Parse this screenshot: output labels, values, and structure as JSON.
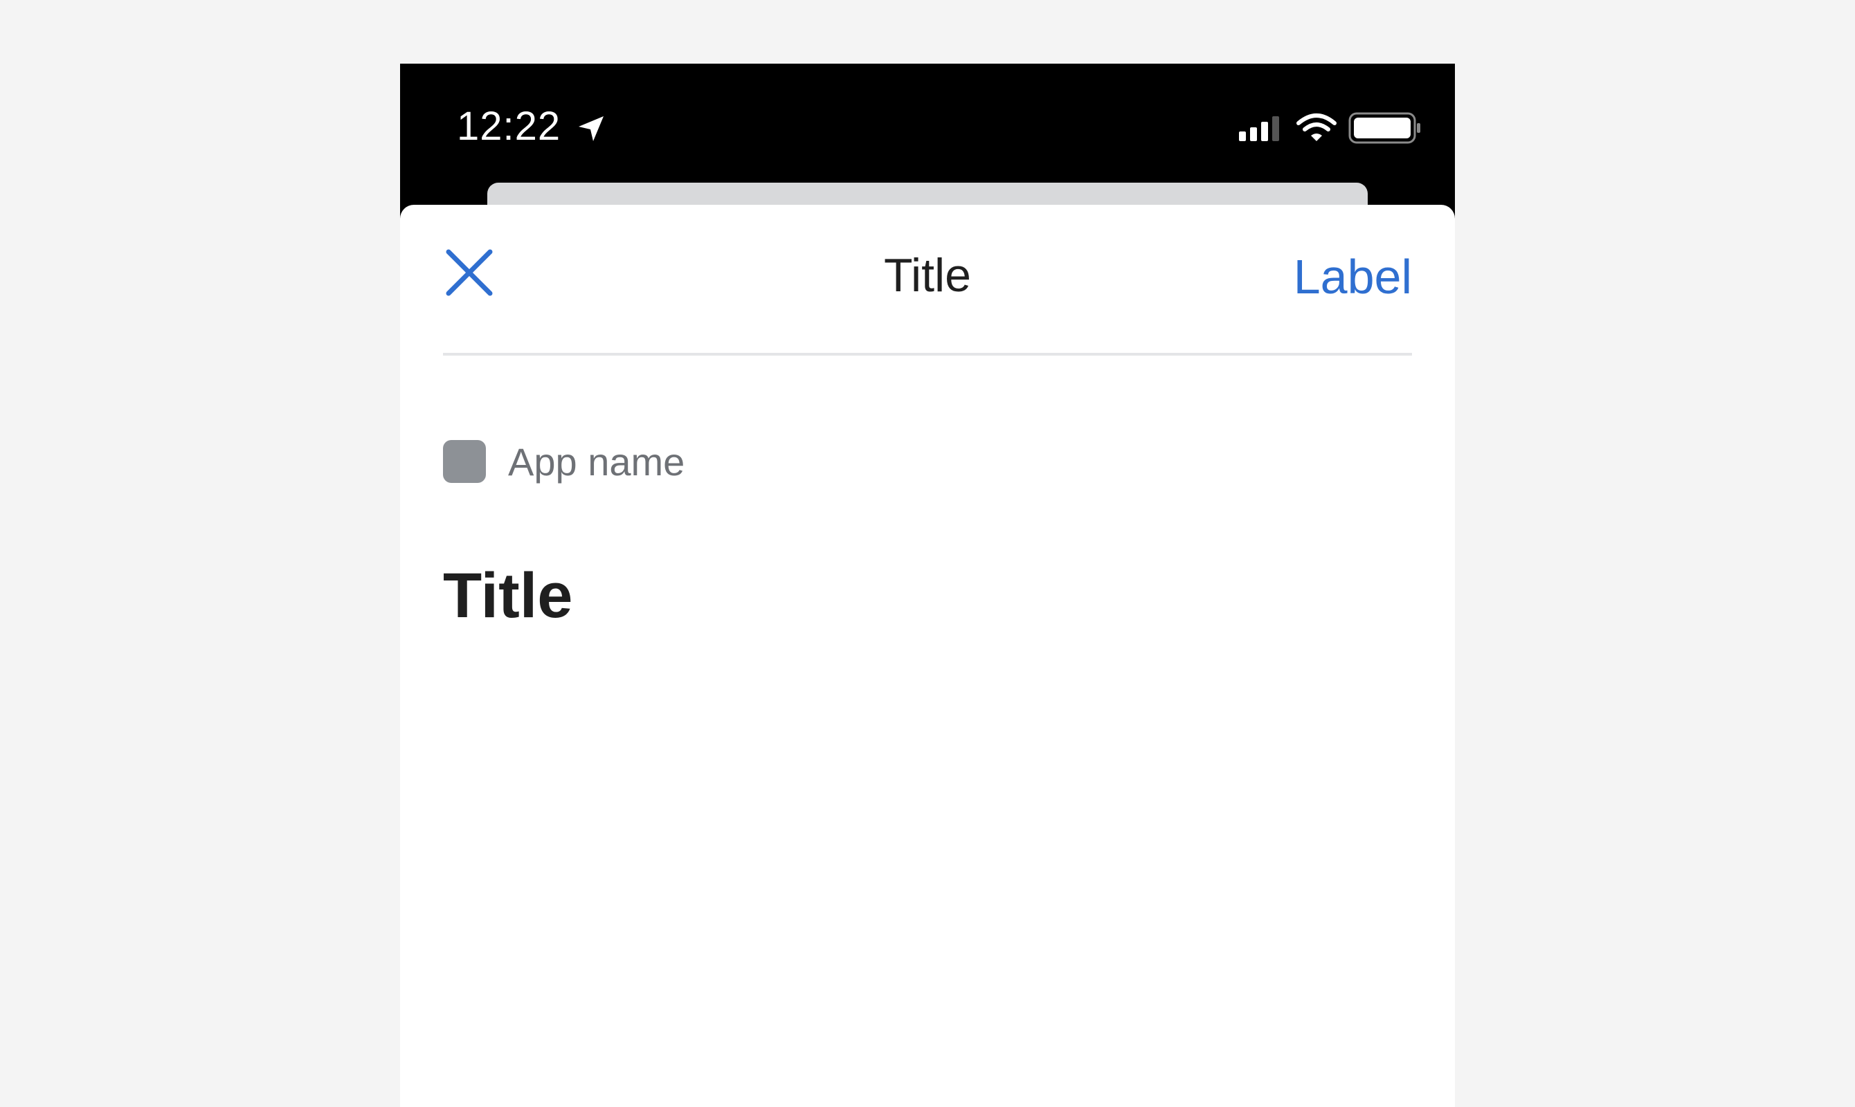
{
  "status_bar": {
    "time": "12:22",
    "icons": [
      "location-arrow-icon",
      "cellular-signal-icon",
      "wifi-icon",
      "battery-icon"
    ]
  },
  "nav_bar": {
    "close_icon": "close-icon",
    "title": "Title",
    "action_label": "Label"
  },
  "app": {
    "icon": "app-icon-placeholder",
    "name": "App name"
  },
  "content": {
    "title": "Title"
  },
  "colors": {
    "page_background": "#f4f4f4",
    "status_bar_background": "#000000",
    "sheet_background": "#ffffff",
    "accent": "#2f6fd0",
    "primary_text": "#1f1f1f",
    "secondary_text": "#6e7176",
    "app_icon": "#8d9196",
    "divider": "#e4e5e7"
  }
}
